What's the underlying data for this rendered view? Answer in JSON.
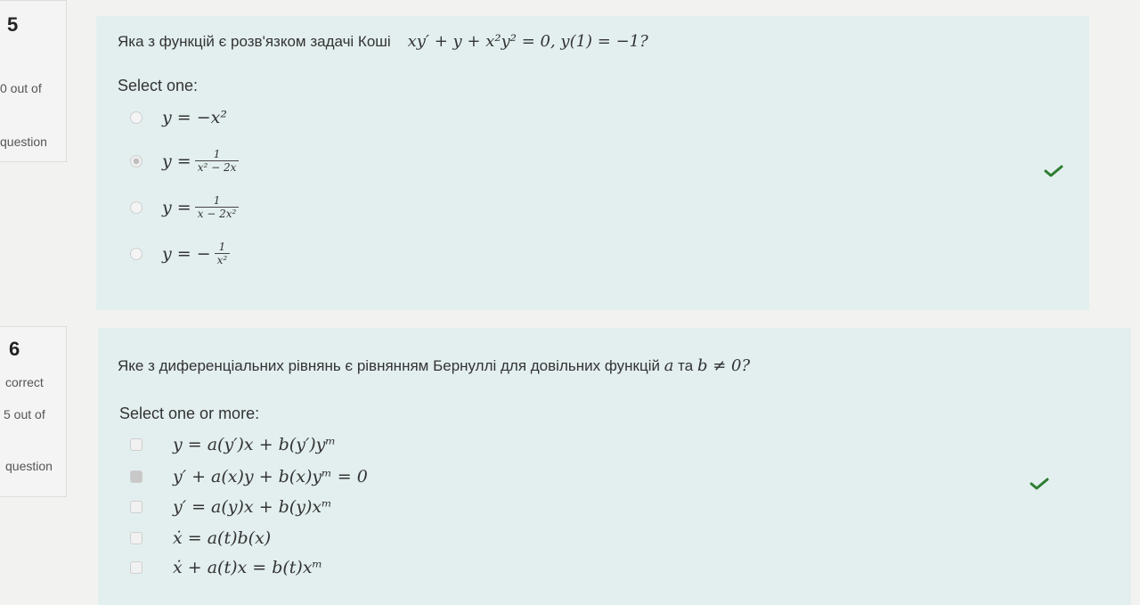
{
  "q5": {
    "number": "5",
    "status": "0 out of",
    "flag": "question",
    "text": "Яка з функцій є розв'язком задачі Коші",
    "equation": "xy′ + y + x²y² = 0,   y(1) = −1?",
    "prompt": "Select one:",
    "options": [
      {
        "lhs": "y = −x²"
      },
      {
        "lhs": "y =",
        "num": "1",
        "den": "x² − 2x"
      },
      {
        "lhs": "y =",
        "num": "1",
        "den": "x − 2x²"
      },
      {
        "lhs": "y = −",
        "num": "1",
        "den": "x²"
      }
    ],
    "selected_index": 1,
    "check_icon": "check-icon",
    "check_color": "#2e7d32"
  },
  "q6": {
    "number": "6",
    "status_correct": "correct",
    "status": "5 out of",
    "flag": "question",
    "text": "Яке з диференціальних рівнянь є рівнянням Бернуллі  для довільних функцій",
    "text_a": "a",
    "text_mid": "та",
    "text_b": "b ≠ 0?",
    "prompt": "Select one or more:",
    "options": [
      {
        "eq": "y = a(y′)x + b(y′)yᵐ"
      },
      {
        "eq": "y′ + a(x)y + b(x)yᵐ = 0"
      },
      {
        "eq": "y′ = a(y)x + b(y)xᵐ"
      },
      {
        "eq": "ẋ = a(t)b(x)"
      },
      {
        "eq": "ẋ + a(t)x = b(t)xᵐ"
      }
    ],
    "selected_index": 1,
    "check_icon": "check-icon",
    "check_color": "#2e7d32"
  }
}
